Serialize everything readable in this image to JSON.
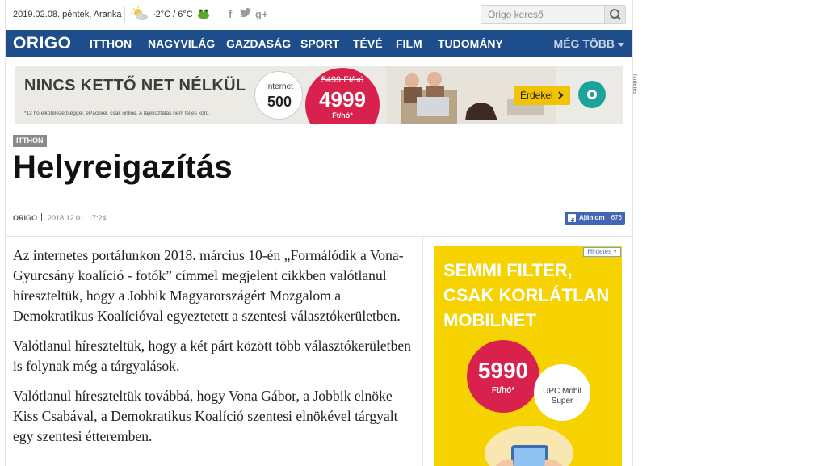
{
  "topbar": {
    "date": "2019.02.08. péntek, Aranka",
    "temperature": "-2°C / 6°C",
    "social": [
      "f",
      "t",
      "g+"
    ],
    "search_placeholder": "Origo kereső"
  },
  "nav": {
    "logo": "ORIGO",
    "items": [
      "ITTHON",
      "NAGYVILÁG",
      "GAZDASÁG",
      "SPORT",
      "TÉVÉ",
      "FILM",
      "TUDOMÁNY"
    ],
    "more": "MÉG TÖBB"
  },
  "banner": {
    "headline": "NINCS KETTŐ NET NÉLKÜL",
    "internet_label": "Internet",
    "internet_speed": "500",
    "old_price": "5499 Ft/hó",
    "price": "4999",
    "price_unit": "Ft/hó*",
    "cta": "Érdekel",
    "fine_print": "*12 hó elkötelezettséggel, ePackkel, csak online. A tájékoztatás nem teljes körű.",
    "side_label": "hirdetés"
  },
  "article": {
    "category": "ITTHON",
    "title": "Helyreigazítás",
    "source": "ORIGO",
    "timestamp": "2018.12.01. 17:24",
    "share_label": "Ajánlom",
    "share_count": "676",
    "paragraphs": [
      "Az internetes portálunkon 2018. március 10-én „Formálódik a Vona-Gyurcsány koalíció - fotók” címmel megjelent cikkben valótlanul híreszteltük, hogy a Jobbik Magyarországért Mozgalom a Demokratikus Koalícióval egyeztetett a szentesi választókerületben.",
      "Valótlanul híreszteltük, hogy a két párt között több választókerületben is folynak még a tárgyalások.",
      "Valótlanul híreszteltük továbbá, hogy Vona Gábor, a Jobbik elnöke Kiss Csabával, a Demokratikus Koalíció szentesi elnökével tárgyalt egy szentesi étteremben."
    ]
  },
  "side_ad": {
    "tag": "Hirdetés ˅",
    "title": "SEMMI FILTER, CSAK KORLÁTLAN MOBILNET",
    "price": "5990",
    "price_unit": "Ft/hó*",
    "sub": "UPC Mobil Super"
  },
  "colors": {
    "nav_bg": "#1d4d8a",
    "accent_red": "#d9214d",
    "ad_yellow": "#f5d200",
    "facebook": "#4267b2"
  }
}
